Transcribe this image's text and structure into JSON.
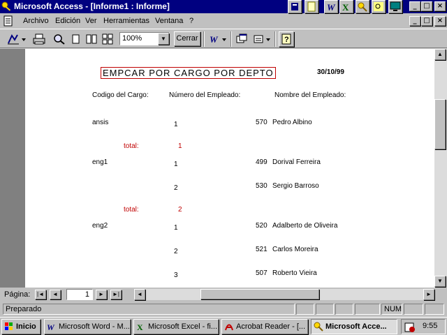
{
  "window": {
    "title": "Microsoft Access - [Informe1 : Informe]",
    "min_symbol": "_",
    "max_symbol": "□",
    "close_symbol": "×"
  },
  "menu": [
    "Archivo",
    "Edición",
    "Ver",
    "Herramientas",
    "Ventana",
    "?"
  ],
  "toolbar": {
    "zoom_value": "100%",
    "close_label": "Cerrar"
  },
  "report": {
    "title": "EMPCAR POR CARGO POR DEPTO",
    "date": "30/10/99",
    "headers": {
      "cargo": "Codigo del Cargo:",
      "numero": "Número del Empleado:",
      "nombre": "Nombre del Empleado:"
    },
    "groups": [
      {
        "cargo": "ansis",
        "rows": [
          {
            "seq": "1",
            "num": "570",
            "name": "Pedro Albino"
          }
        ],
        "total_label": "total:",
        "total": "1"
      },
      {
        "cargo": "eng1",
        "rows": [
          {
            "seq": "1",
            "num": "499",
            "name": "Dorival Ferreira"
          },
          {
            "seq": "2",
            "num": "530",
            "name": "Sergio Barroso"
          }
        ],
        "total_label": "total:",
        "total": "2"
      },
      {
        "cargo": "eng2",
        "rows": [
          {
            "seq": "1",
            "num": "520",
            "name": "Adalberto de Oliveira"
          },
          {
            "seq": "2",
            "num": "521",
            "name": "Carlos Moreira"
          },
          {
            "seq": "3",
            "num": "507",
            "name": "Roberto Vieira"
          }
        ]
      }
    ]
  },
  "navigation": {
    "page_label": "Página:",
    "page_value": "1"
  },
  "status": {
    "text": "Preparado",
    "num": "NUM"
  },
  "taskbar": {
    "start": "Inicio",
    "tasks": [
      "Microsoft Word - M...",
      "Microsoft Excel - fi...",
      "Acrobat Reader - [...",
      "Microsoft Acce..."
    ],
    "clock": "9:55"
  },
  "colors": {
    "titlebar": "#000080",
    "face": "#c0c0c0",
    "report_accent": "#c00000"
  }
}
